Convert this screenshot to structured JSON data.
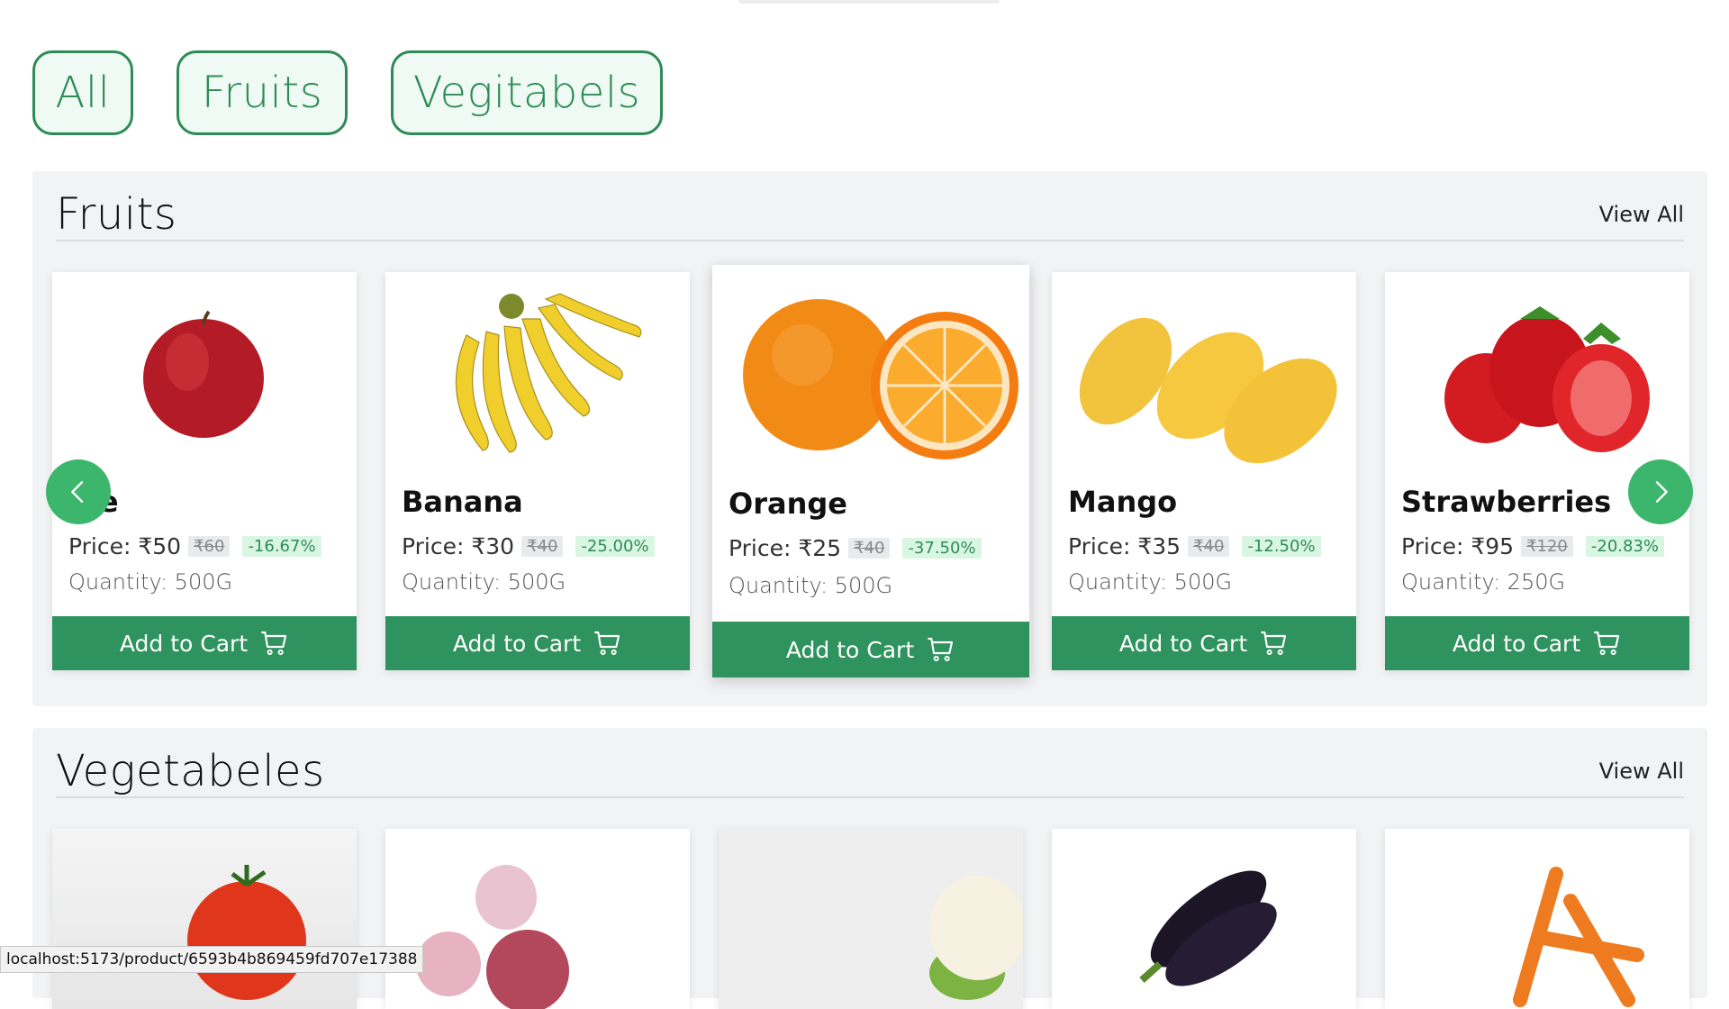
{
  "filters": [
    "All",
    "Fruits",
    "Vegitabels"
  ],
  "sections": {
    "fruits": {
      "title": "Fruits",
      "view_all": "View All"
    },
    "vegetables": {
      "title": "Vegetabeles",
      "view_all": "View All"
    }
  },
  "fruits": [
    {
      "name": "ple",
      "price": "Price: ₹50",
      "mrp": "₹60",
      "discount": "-16.67%",
      "quantity": "Quantity: 500G",
      "cart": "Add to Cart"
    },
    {
      "name": "Banana",
      "price": "Price: ₹30",
      "mrp": "₹40",
      "discount": "-25.00%",
      "quantity": "Quantity: 500G",
      "cart": "Add to Cart"
    },
    {
      "name": "Orange",
      "price": "Price: ₹25",
      "mrp": "₹40",
      "discount": "-37.50%",
      "quantity": "Quantity: 500G",
      "cart": "Add to Cart"
    },
    {
      "name": "Mango",
      "price": "Price: ₹35",
      "mrp": "₹40",
      "discount": "-12.50%",
      "quantity": "Quantity: 500G",
      "cart": "Add to Cart"
    },
    {
      "name": "Strawberries",
      "price": "Price: ₹95",
      "mrp": "₹120",
      "discount": "-20.83%",
      "quantity": "Quantity: 250G",
      "cart": "Add to Cart"
    }
  ],
  "icons": {
    "prev": "chevron-left-icon",
    "next": "chevron-right-icon",
    "cart": "cart-icon"
  },
  "colors": {
    "accent": "#2e8b57",
    "button": "#2e935e",
    "arrow": "#3cb66c"
  },
  "status_url": "localhost:5173/product/6593b4b869459fd707e17388"
}
